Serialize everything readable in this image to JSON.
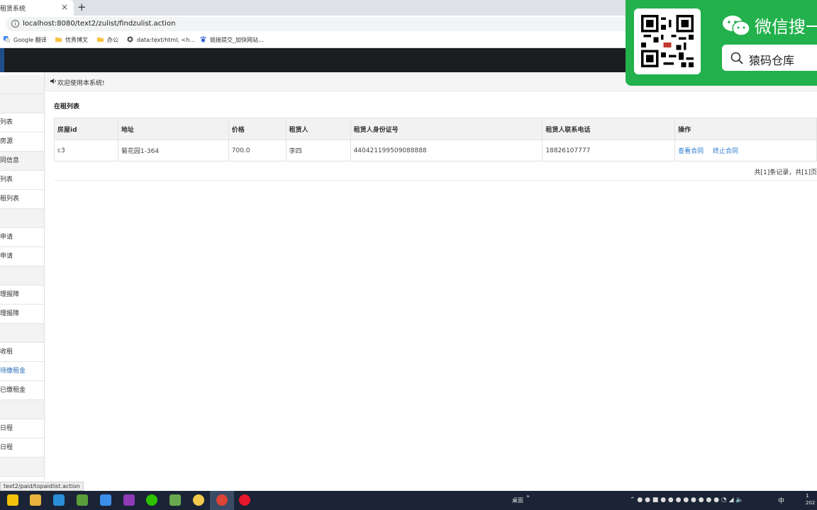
{
  "browser": {
    "tab_title": "租赁系统",
    "tab_close": "×",
    "new_tab": "+",
    "url": "localhost:8080/text2/zulist/findzulist.action",
    "bookmarks": [
      {
        "label": "Google 翻译",
        "icon": "translate-icon",
        "color": "#4285f4"
      },
      {
        "label": "优秀博文",
        "icon": "folder-icon",
        "color": "#f5c342"
      },
      {
        "label": "办公",
        "icon": "folder-icon",
        "color": "#f5c342"
      },
      {
        "label": "data:text/html, <h...",
        "icon": "globe-icon",
        "color": "#555555"
      },
      {
        "label": "链接提交_加快网站...",
        "icon": "paw-icon",
        "color": "#3366cc"
      }
    ]
  },
  "sidebar": {
    "items": [
      {
        "label": "",
        "group": true
      },
      {
        "label": "",
        "group": true
      },
      {
        "label": "列表",
        "group": false
      },
      {
        "label": "房源",
        "group": false
      },
      {
        "label": "同信息",
        "group": true
      },
      {
        "label": "列表",
        "group": false
      },
      {
        "label": "租列表",
        "group": false
      },
      {
        "label": "",
        "group": true
      },
      {
        "label": "申请",
        "group": false
      },
      {
        "label": "申请",
        "group": false
      },
      {
        "label": "",
        "group": true
      },
      {
        "label": "理报障",
        "group": false
      },
      {
        "label": "理报障",
        "group": false
      },
      {
        "label": "",
        "group": true
      },
      {
        "label": "收租",
        "group": false
      },
      {
        "label": "待缴租金",
        "group": false,
        "active": true
      },
      {
        "label": "已缴租金",
        "group": false
      },
      {
        "label": "",
        "group": true
      },
      {
        "label": "日程",
        "group": false
      },
      {
        "label": "日程",
        "group": false
      },
      {
        "label": "",
        "group": true
      }
    ]
  },
  "main": {
    "welcome": "欢迎使用本系统!",
    "list_title": "在租列表",
    "table": {
      "headers": [
        "房屋id",
        "地址",
        "价格",
        "租赁人",
        "租赁人身份证号",
        "租赁人联系电话",
        "操作"
      ],
      "rows": [
        {
          "id": "c3",
          "address": "菊花园1-364",
          "price": "700.0",
          "tenant": "李四",
          "id_card": "440421199509088888",
          "phone": "18826107777",
          "actions": [
            "查看合同",
            "终止合同"
          ]
        }
      ]
    },
    "pager": "共[1]条记录，共[1]页"
  },
  "status_url": "text2/paid/topaidlist.action",
  "promo": {
    "title": "微信搜一搜",
    "search_text": "猿码仓库",
    "bg_color": "#22b14c"
  },
  "taskbar": {
    "desk_label": "桌面",
    "overflow": "»",
    "ime": "中",
    "clock_time": "1",
    "clock_date": "202"
  },
  "colors": {
    "header_bg": "#1c1d21",
    "link": "#2a7bd1",
    "taskbar_bg": "#1a2436"
  }
}
